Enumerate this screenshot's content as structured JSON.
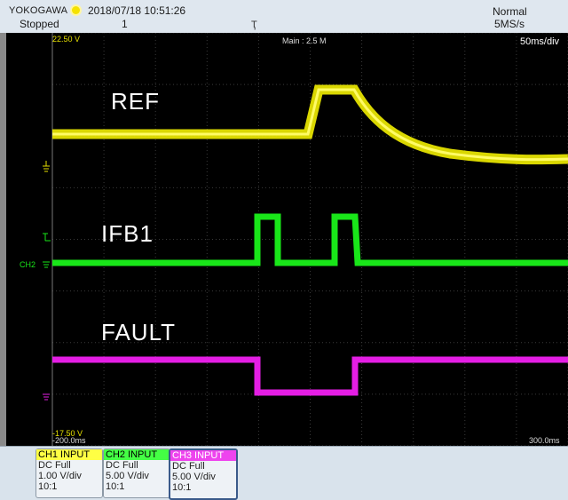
{
  "header": {
    "brand": "YOKOGAWA",
    "datetime": "2018/07/18 10:51:26",
    "status": "Stopped",
    "count": "1",
    "mode": "Normal",
    "sample_rate": "5MS/s",
    "trigger_symbol": "Ҭ"
  },
  "screen": {
    "top_voltage": "22.50 V",
    "main_memory": "Main : 2.5 M",
    "time_per_div": "50ms/div",
    "bottom_voltage": "-17.50 V",
    "time_start": "-200.0ms",
    "time_end": "300.0ms",
    "ch2_marker": "CH2"
  },
  "traces": [
    {
      "name": "REF",
      "color": "#f2ee00"
    },
    {
      "name": "IFB1",
      "color": "#19e619"
    },
    {
      "name": "FAULT",
      "color": "#e41ee4"
    }
  ],
  "channels": [
    {
      "header": "CH1 INPUT",
      "coupling": "DC Full",
      "scale": "1.00 V/div",
      "probe": "10:1",
      "color": "#ffff44",
      "selected": false
    },
    {
      "header": "CH2 INPUT",
      "coupling": "DC Full",
      "scale": "5.00 V/div",
      "probe": "10:1",
      "color": "#44ff44",
      "selected": false
    },
    {
      "header": "CH3 INPUT",
      "coupling": "DC Full",
      "scale": "5.00 V/div",
      "probe": "10:1",
      "color": "#ee44ee",
      "selected": true
    }
  ]
}
